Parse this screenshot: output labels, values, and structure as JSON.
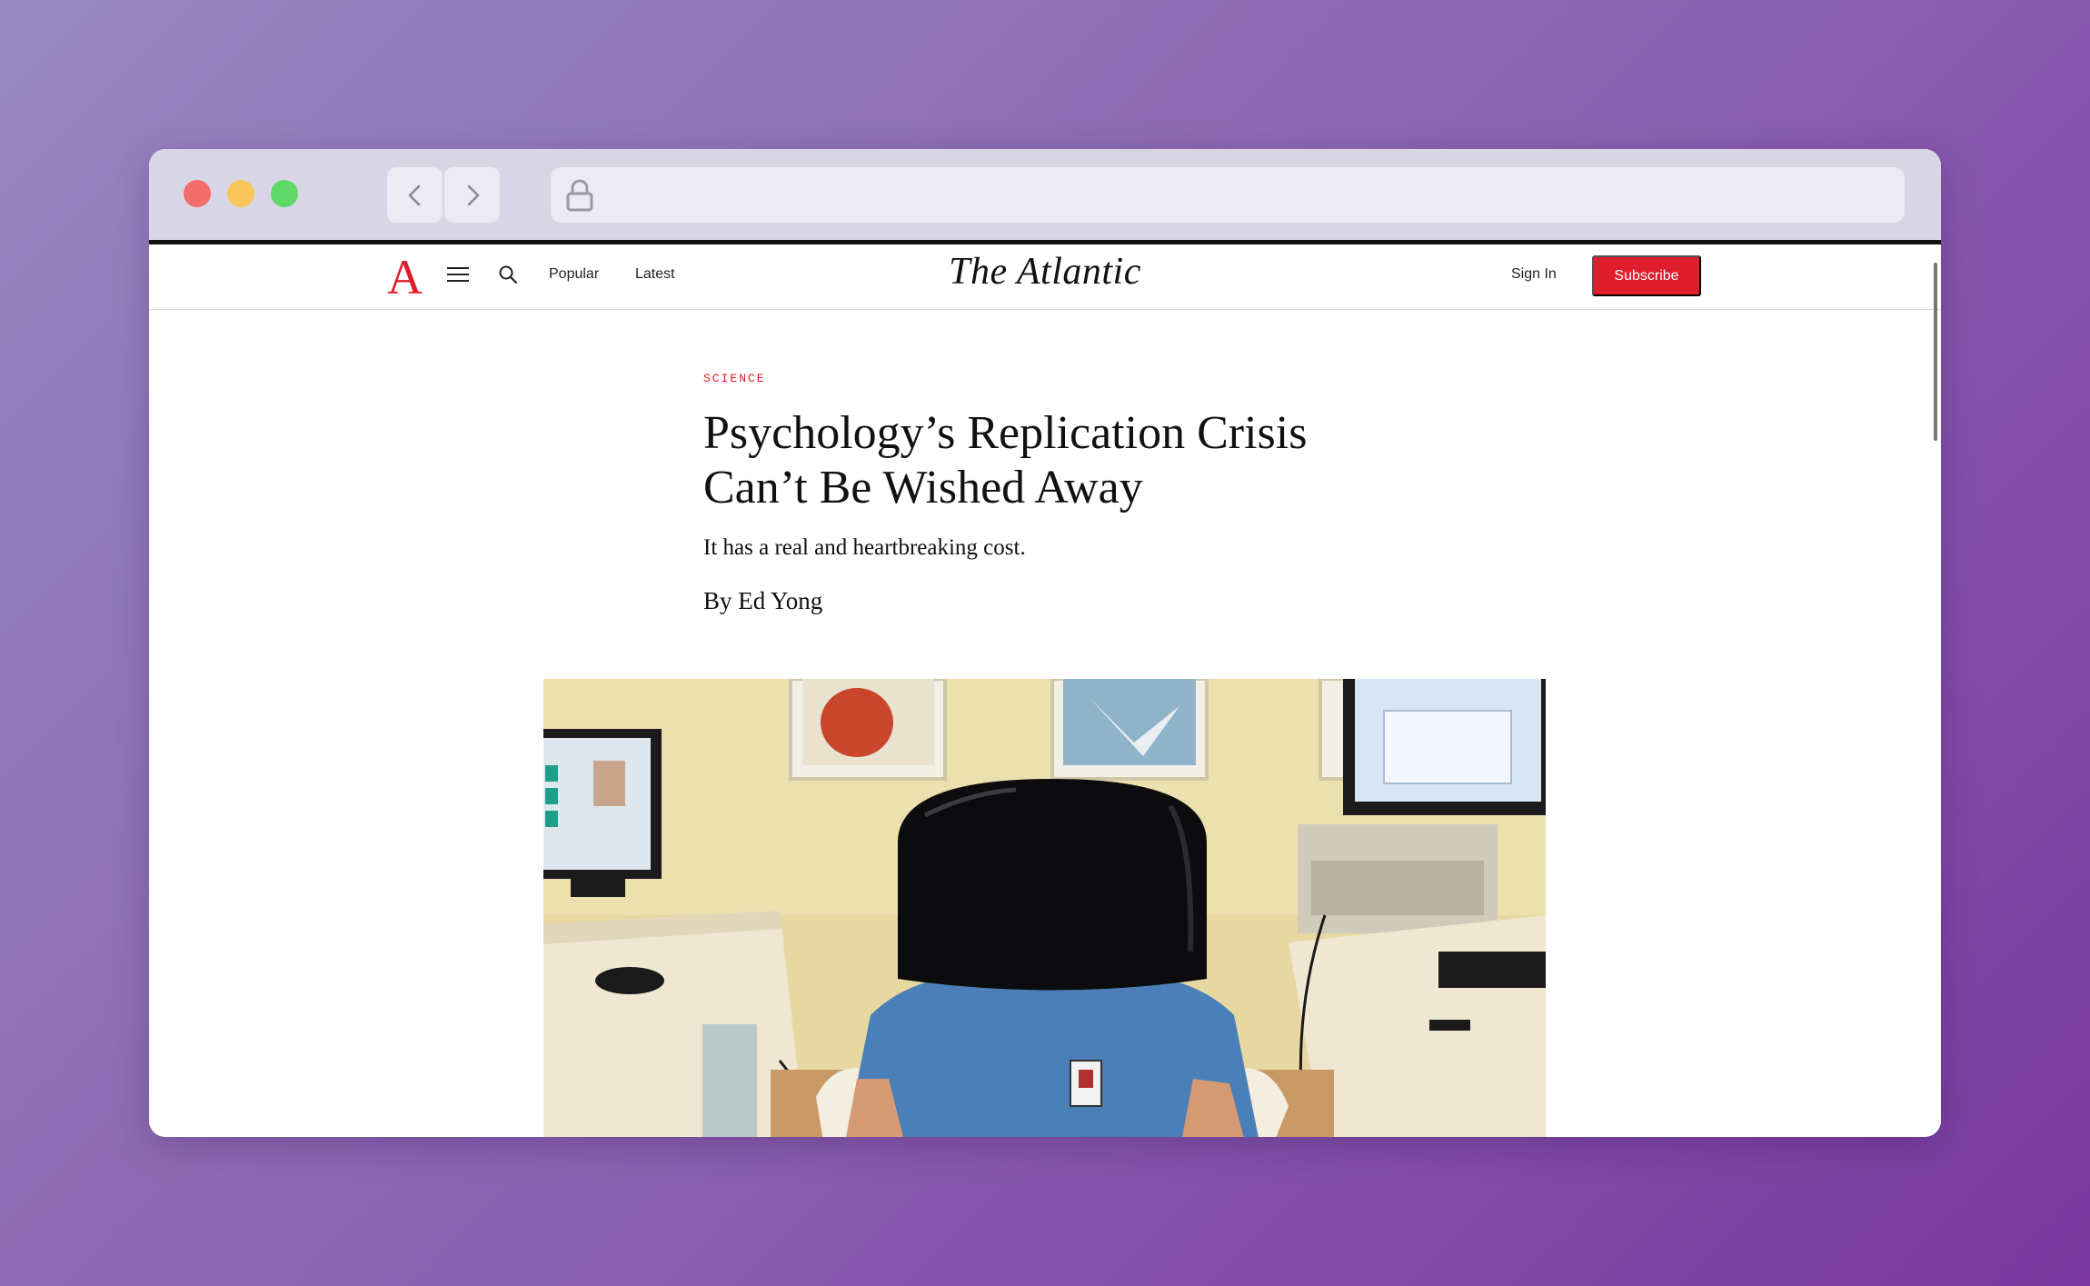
{
  "browser": {
    "url": ""
  },
  "site": {
    "logo_letter": "A",
    "masthead": "The Atlantic",
    "nav": [
      {
        "label": "Popular"
      },
      {
        "label": "Latest"
      }
    ],
    "sign_in_label": "Sign In",
    "subscribe_label": "Subscribe",
    "accent_color": "#e01d2b"
  },
  "article": {
    "section": "SCIENCE",
    "headline": "Psychology’s Replication Crisis Can’t Be Wished Away",
    "dek": "It has a real and heartbreaking cost.",
    "byline": "By Ed Yong",
    "hero_image": "photo of a seated person in a blue uniform with a large black dome-shaped device covering their head, between computer monitors on desks"
  },
  "icons": {
    "menu": "hamburger-menu-icon",
    "search": "search-icon",
    "lock": "lock-icon",
    "back": "chevron-left-icon",
    "forward": "chevron-right-icon"
  }
}
